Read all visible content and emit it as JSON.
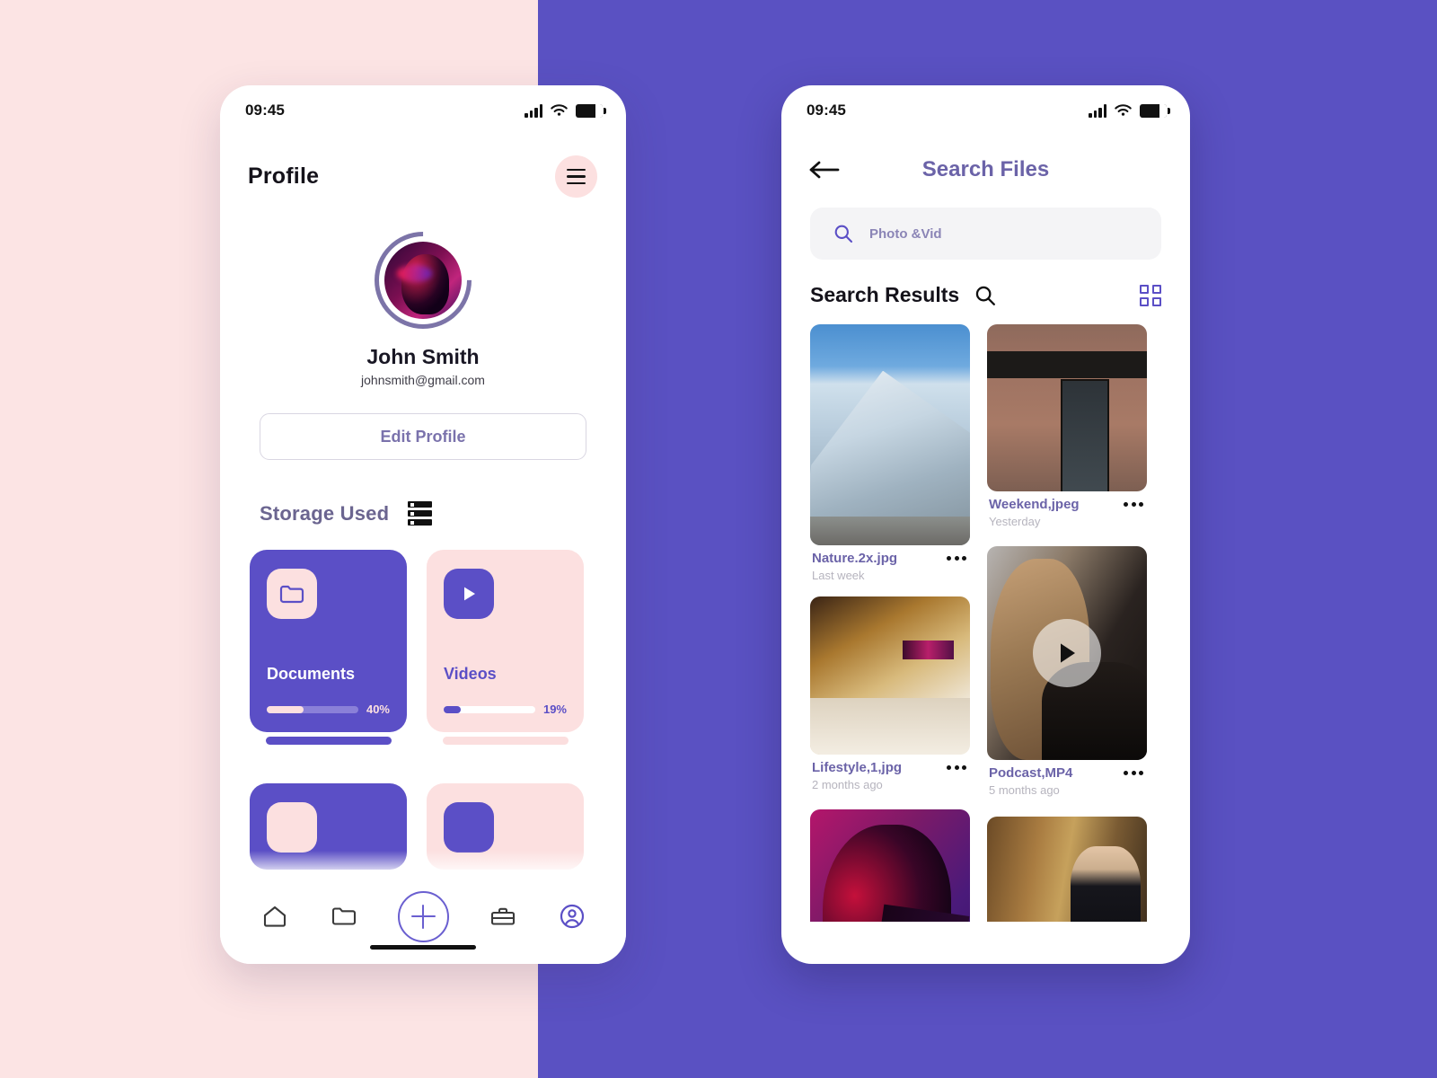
{
  "background": {
    "left_color": "#fce4e4",
    "right_color": "#5a51c2"
  },
  "theme": {
    "primary_purple": "#5b4fc6",
    "soft_pink": "#fce0e0",
    "title_purple": "#6b63a8",
    "muted": "#b6b4be"
  },
  "left_phone": {
    "status": {
      "time": "09:45",
      "signal_icon": "signal-bars-icon",
      "wifi_icon": "wifi-icon",
      "battery_icon": "battery-icon"
    },
    "header": {
      "title": "Profile",
      "menu_icon": "hamburger-menu-icon"
    },
    "profile": {
      "avatar_icon": "user-avatar-image",
      "name": "John Smith",
      "email": "johnsmith@gmail.com",
      "edit_button": "Edit Profile"
    },
    "storage": {
      "section_title": "Storage Used",
      "section_icon": "server-storage-icon",
      "cards": [
        {
          "label": "Documents",
          "percent_label": "40%",
          "percent": 40,
          "icon": "folder-icon",
          "style": "purple"
        },
        {
          "label": "Videos",
          "percent_label": "19%",
          "percent": 19,
          "icon": "play-icon",
          "style": "pink"
        }
      ],
      "cards_row2": [
        {
          "style": "purple",
          "icon": "folder-icon"
        },
        {
          "style": "pink",
          "icon": "play-icon"
        }
      ]
    },
    "tabbar": {
      "items": [
        {
          "name": "home",
          "icon": "home-icon"
        },
        {
          "name": "files",
          "icon": "folder-icon"
        },
        {
          "name": "add",
          "icon": "plus-circle-icon"
        },
        {
          "name": "tools",
          "icon": "toolbox-icon"
        },
        {
          "name": "profile",
          "icon": "person-circle-icon"
        }
      ]
    }
  },
  "right_phone": {
    "status": {
      "time": "09:45",
      "signal_icon": "signal-bars-icon",
      "wifi_icon": "wifi-icon",
      "battery_icon": "battery-icon"
    },
    "header": {
      "back_icon": "back-arrow-icon",
      "title": "Search Files"
    },
    "search": {
      "icon": "search-icon",
      "placeholder": "Photo &Vid",
      "value": ""
    },
    "results": {
      "title": "Search Results",
      "title_icon": "search-icon",
      "grid_toggle_icon": "grid-view-icon",
      "items": [
        {
          "name": "Nature.2x.jpg",
          "date": "Last week",
          "thumb": "snowy-mountain-photo",
          "column": "left",
          "menu_icon": "more-options-icon",
          "is_video": false
        },
        {
          "name": "Weekend,jpeg",
          "date": "Yesterday",
          "thumb": "brick-restaurant-photo",
          "column": "right",
          "menu_icon": "more-options-icon",
          "is_video": false
        },
        {
          "name": "Lifestyle,1,jpg",
          "date": "2 months ago",
          "thumb": "hotel-bedroom-photo",
          "column": "left",
          "menu_icon": "more-options-icon",
          "is_video": false
        },
        {
          "name": "Podcast,MP4",
          "date": "5 months ago",
          "thumb": "woman-portrait-video",
          "column": "right",
          "menu_icon": "more-options-icon",
          "is_video": true
        },
        {
          "name": "",
          "date": "",
          "thumb": "neon-cap-portrait-photo",
          "column": "left",
          "menu_icon": "more-options-icon",
          "is_video": false
        },
        {
          "name": "",
          "date": "",
          "thumb": "man-in-suit-photo",
          "column": "right",
          "menu_icon": "more-options-icon",
          "is_video": false
        }
      ]
    }
  }
}
